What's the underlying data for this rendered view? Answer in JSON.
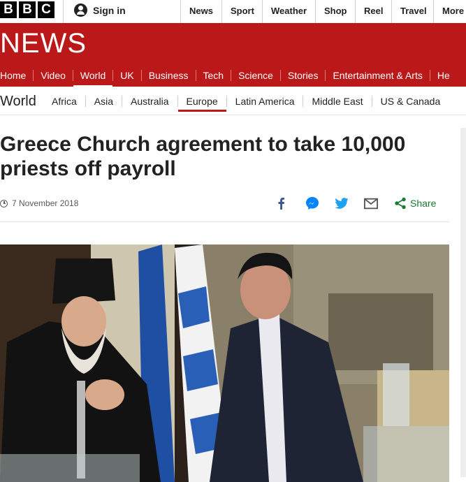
{
  "brand": {
    "letters": [
      "B",
      "B",
      "C"
    ]
  },
  "account": {
    "signin_label": "Sign in"
  },
  "topnav": [
    "News",
    "Sport",
    "Weather",
    "Shop",
    "Reel",
    "Travel",
    "More"
  ],
  "banner": {
    "wordmark": "NEWS"
  },
  "mainnav": [
    "Home",
    "Video",
    "World",
    "UK",
    "Business",
    "Tech",
    "Science",
    "Stories",
    "Entertainment & Arts",
    "He"
  ],
  "subnav": {
    "section": "World",
    "items": [
      "Africa",
      "Asia",
      "Australia",
      "Europe",
      "Latin America",
      "Middle East",
      "US & Canada"
    ]
  },
  "article": {
    "headline": "Greece Church agreement to take 10,000 priests off payroll",
    "date": "7 November 2018"
  },
  "share": {
    "label": "Share",
    "icons": [
      "facebook-icon",
      "messenger-icon",
      "twitter-icon",
      "email-icon",
      "share-icon"
    ]
  },
  "colors": {
    "brand_red": "#bb1919",
    "share_green": "#1b7a2f",
    "facebook_blue": "#3b5998",
    "messenger_blue": "#0084ff",
    "twitter_blue": "#1da1f2"
  }
}
